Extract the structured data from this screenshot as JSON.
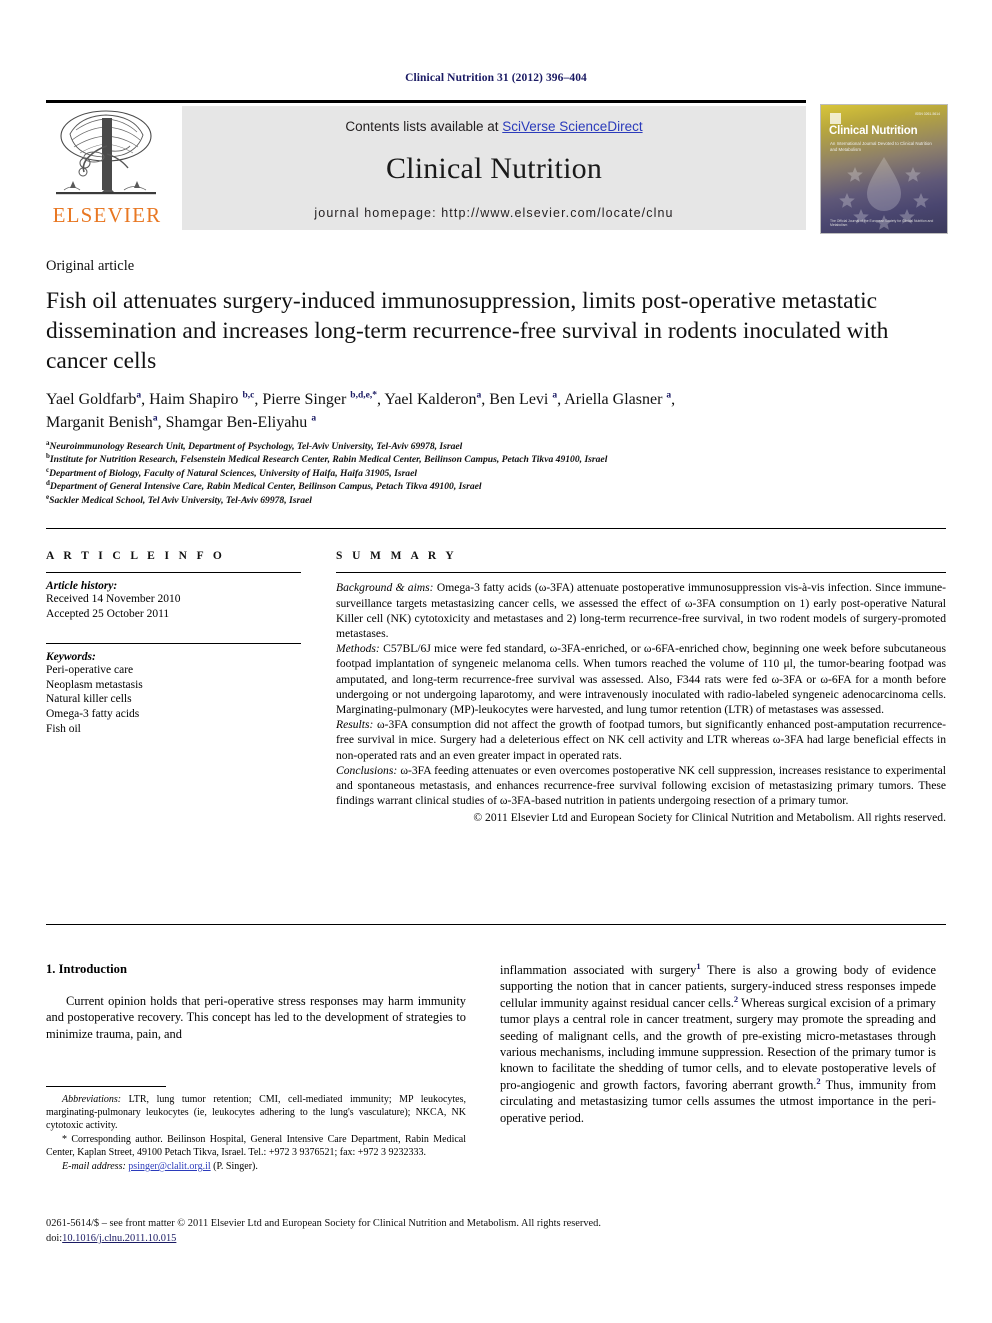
{
  "running_head": "Clinical Nutrition 31 (2012) 396–404",
  "masthead": {
    "contents_prefix": "Contents lists available at ",
    "sciencedirect_link": "SciVerse ScienceDirect",
    "journal_name": "Clinical Nutrition",
    "homepage_label": "journal homepage: http://www.elsevier.com/locate/clnu",
    "publisher_wordmark": "ELSEVIER",
    "publisher_logo_alt": "elsevier-tree-logo",
    "cover": {
      "title": "Clinical Nutrition",
      "subtitle": "An International Journal Devoted to Clinical Nutrition and Metabolism",
      "footer": "The Official Journal of the European Society for Clinical Nutrition and Metabolism",
      "issn": "ISSN 0261-5614"
    }
  },
  "article": {
    "kind": "Original article",
    "title": "Fish oil attenuates surgery-induced immunosuppression, limits post-operative metastatic dissemination and increases long-term recurrence-free survival in rodents inoculated with cancer cells",
    "authors": [
      {
        "name": "Yael Goldfarb",
        "marks": "a"
      },
      {
        "name": "Haim Shapiro",
        "marks": "b,c"
      },
      {
        "name": "Pierre Singer",
        "marks": "b,d,e,*"
      },
      {
        "name": "Yael Kalderon",
        "marks": "a"
      },
      {
        "name": "Ben Levi",
        "marks": "a"
      },
      {
        "name": "Ariella Glasner",
        "marks": "a"
      },
      {
        "name": "Marganit Benish",
        "marks": "a"
      },
      {
        "name": "Shamgar Ben-Eliyahu",
        "marks": "a"
      }
    ],
    "affiliations": [
      {
        "mark": "a",
        "text": "Neuroimmunology Research Unit, Department of Psychology, Tel-Aviv University, Tel-Aviv 69978, Israel"
      },
      {
        "mark": "b",
        "text": "Institute for Nutrition Research, Felsenstein Medical Research Center, Rabin Medical Center, Beilinson Campus, Petach Tikva 49100, Israel"
      },
      {
        "mark": "c",
        "text": "Department of Biology, Faculty of Natural Sciences, University of Haifa, Haifa 31905, Israel"
      },
      {
        "mark": "d",
        "text": "Department of General Intensive Care, Rabin Medical Center, Beilinson Campus, Petach Tikva 49100, Israel"
      },
      {
        "mark": "e",
        "text": "Sackler Medical School, Tel Aviv University, Tel-Aviv 69978, Israel"
      }
    ]
  },
  "article_info": {
    "heading": "A R T I C L E  I N F O",
    "history_label": "Article history:",
    "history_lines": [
      "Received 14 November 2010",
      "Accepted 25 October 2011"
    ],
    "keywords_label": "Keywords:",
    "keywords": [
      "Peri-operative care",
      "Neoplasm metastasis",
      "Natural killer cells",
      "Omega-3 fatty acids",
      "Fish oil"
    ]
  },
  "summary": {
    "heading": "S U M M A R Y",
    "background_label": "Background & aims:",
    "background_text": " Omega-3 fatty acids (ω-3FA) attenuate postoperative immunosuppression vis-à-vis infection. Since immune-surveillance targets metastasizing cancer cells, we assessed the effect of ω-3FA consumption on 1) early post-operative Natural Killer cell (NK) cytotoxicity and metastases and 2) long-term recurrence-free survival, in two rodent models of surgery-promoted metastases.",
    "methods_label": "Methods:",
    "methods_text": " C57BL/6J mice were fed standard, ω-3FA-enriched, or ω-6FA-enriched chow, beginning one week before subcutaneous footpad implantation of syngeneic melanoma cells. When tumors reached the volume of 110 μl, the tumor-bearing footpad was amputated, and long-term recurrence-free survival was assessed. Also, F344 rats were fed ω-3FA or ω-6FA for a month before undergoing or not undergoing laparotomy, and were intravenously inoculated with radio-labeled syngeneic adenocarcinoma cells. Marginating-pulmonary (MP)-leukocytes were harvested, and lung tumor retention (LTR) of metastases was assessed.",
    "results_label": "Results:",
    "results_text": " ω-3FA consumption did not affect the growth of footpad tumors, but significantly enhanced post-amputation recurrence-free survival in mice. Surgery had a deleterious effect on NK cell activity and LTR whereas ω-3FA had large beneficial effects in non-operated rats and an even greater impact in operated rats.",
    "conclusions_label": "Conclusions:",
    "conclusions_text": " ω-3FA feeding attenuates or even overcomes postoperative NK cell suppression, increases resistance to experimental and spontaneous metastasis, and enhances recurrence-free survival following excision of metastasizing primary tumors. These findings warrant clinical studies of ω-3FA-based nutrition in patients undergoing resection of a primary tumor.",
    "copyright": "© 2011 Elsevier Ltd and European Society for Clinical Nutrition and Metabolism. All rights reserved."
  },
  "body": {
    "section_number_title": "1.  Introduction",
    "left_paragraph": "Current opinion holds that peri-operative stress responses may harm immunity and postoperative recovery. This concept has led to the development of strategies to minimize trauma, pain, and",
    "right_paragraph_1a": "inflammation associated with surgery",
    "right_ref_1": "1",
    "right_paragraph_1b": " There is also a growing body of evidence supporting the notion that in cancer patients, surgery-induced stress responses impede cellular immunity against residual cancer cells.",
    "right_ref_2": "2",
    "right_paragraph_1c": " Whereas surgical excision of a primary tumor plays a central role in cancer treatment, surgery may promote the spreading and seeding of malignant cells, and the growth of pre-existing micro-metastases through various mechanisms, including immune suppression. Resection of the primary tumor is known to facilitate the shedding of tumor cells, and to elevate postoperative levels of pro-angiogenic and growth factors, favoring aberrant growth.",
    "right_ref_3": "2",
    "right_paragraph_1d": " Thus, immunity from circulating and metastasizing tumor cells assumes the utmost importance in the peri-operative period."
  },
  "footnotes": {
    "abbreviations_label": "Abbreviations:",
    "abbreviations_text": " LTR, lung tumor retention; CMI, cell-mediated immunity; MP leukocytes, marginating-pulmonary leukocytes (ie, leukocytes adhering to the lung's vasculature); NKCA, NK cytotoxic activity.",
    "corresponding_text": "* Corresponding author. Beilinson Hospital, General Intensive Care Department, Rabin Medical Center, Kaplan Street, 49100 Petach Tikva, Israel. Tel.: +972 3 9376521; fax: +972 3 9232333.",
    "email_label": "E-mail address:",
    "email_address": "psinger@clalit.org.il",
    "email_owner": " (P. Singer)."
  },
  "footer": {
    "front_matter": "0261-5614/$ – see front matter © 2011 Elsevier Ltd and European Society for Clinical Nutrition and Metabolism. All rights reserved.",
    "doi_label": "doi:",
    "doi_value": "10.1016/j.clnu.2011.10.015"
  },
  "colors": {
    "link_blue": "#2b3bbb",
    "navy": "#1a1a63",
    "elsevier_orange": "#e87722",
    "band_gray": "#e6e6e6"
  }
}
